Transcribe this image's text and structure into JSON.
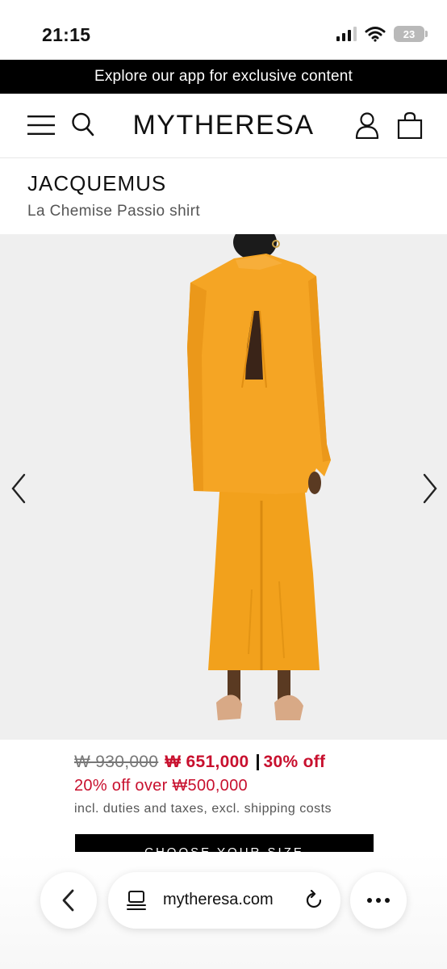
{
  "status_bar": {
    "time": "21:15",
    "battery_level": "23",
    "icons": [
      "cellular-signal-icon",
      "wifi-icon",
      "battery-icon"
    ]
  },
  "promo": {
    "text": "Explore our app for exclusive content"
  },
  "header": {
    "logo": "MYTHERESA",
    "icons": [
      "menu-icon",
      "search-icon",
      "account-icon",
      "shopping-bag-icon"
    ]
  },
  "product": {
    "brand": "JACQUEMUS",
    "name": "La Chemise Passio shirt",
    "image_description_icon": "product-photo",
    "colors": {
      "garment": "#f4a11f",
      "background": "#efefef"
    }
  },
  "pricing": {
    "original_price": "₩ 930,000",
    "sale_price": "₩ 651,000",
    "discount": "30% off",
    "extra_offer": "20% off over ₩500,000",
    "tax_note": "incl. duties and taxes, excl. shipping costs"
  },
  "actions": {
    "choose_size": "CHOOSE YOUR SIZE"
  },
  "browser": {
    "url": "mytheresa.com",
    "icons": [
      "back-arrow-icon",
      "tabs-icon",
      "reload-icon",
      "more-icon"
    ]
  },
  "colors": {
    "accent_red": "#c8102e",
    "black": "#000000"
  }
}
